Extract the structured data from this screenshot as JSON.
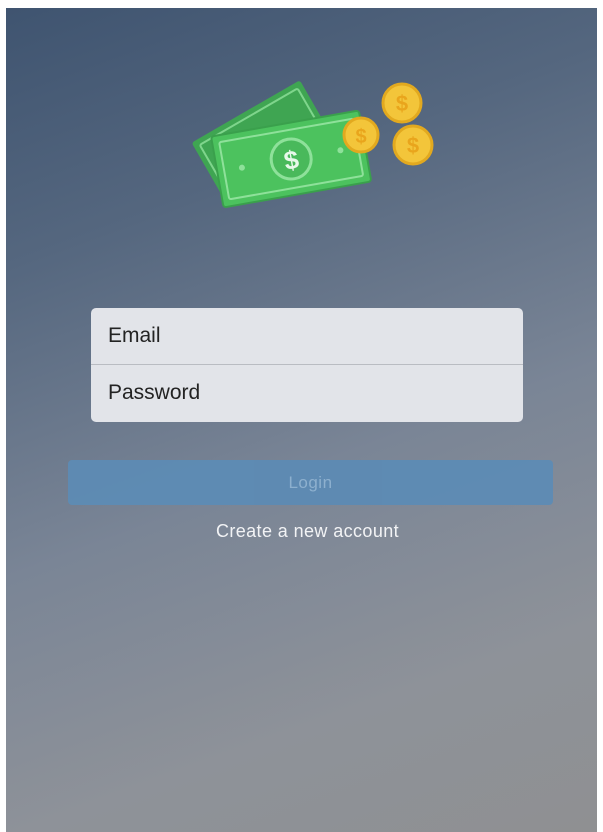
{
  "login_form": {
    "email_placeholder": "Email",
    "password_placeholder": "Password",
    "login_label": "Login",
    "create_account_label": "Create a new account"
  },
  "logo": {
    "icon": "money-bills-and-coins-icon",
    "bill_symbol": "$",
    "coin_symbol": "$"
  },
  "colors": {
    "bill_green": "#4cc25e",
    "coin_gold": "#f3c53a",
    "login_button": "#5d8bb4"
  }
}
